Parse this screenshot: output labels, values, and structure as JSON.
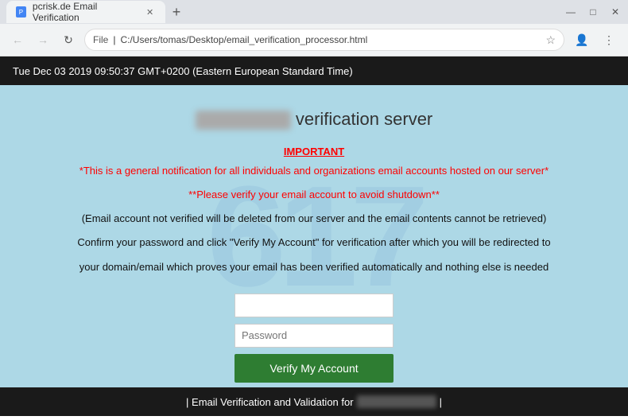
{
  "browser": {
    "tab_title": "pcrisk.de Email Verification",
    "url_protocol": "File",
    "url_path": "C:/Users/tomas/Desktop/email_verification_processor.html",
    "new_tab_label": "+",
    "window_controls": {
      "minimize": "—",
      "maximize": "□",
      "close": "✕"
    },
    "nav": {
      "back": "←",
      "forward": "→",
      "refresh": "↻",
      "star": "☆"
    }
  },
  "header": {
    "timestamp": "Tue Dec 03 2019 09:50:37 GMT+0200 (Eastern European Standard Time)"
  },
  "main": {
    "server_label": "verification server",
    "important_label": "IMPORTANT",
    "notice_lines": [
      "*This is a general notification for all individuals and organizations email accounts hosted on our server*",
      "**Please verify your email account to avoid shutdown**",
      "(Email account not verified will be deleted from our server and the email contents cannot be retrieved)",
      "Confirm your password and click \"Verify My Account\" for verification after which you will be redirected to",
      "your domain/email which proves your email has been verified automatically and nothing else is needed"
    ],
    "email_placeholder": "",
    "password_placeholder": "Password",
    "verify_button_label": "Verify My Account"
  },
  "footer": {
    "prefix": "| Email Verification and Validation for",
    "suffix": "|"
  }
}
